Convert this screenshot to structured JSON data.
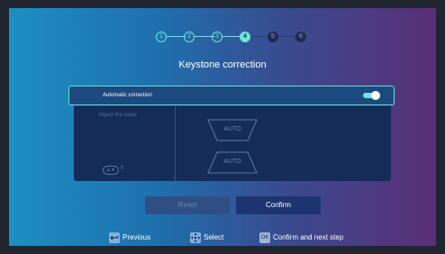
{
  "steps": {
    "items": [
      "1",
      "2",
      "3",
      "4",
      "5",
      "6"
    ],
    "current": 4
  },
  "title": "Keystone correction",
  "automatic_correction": {
    "label": "Automatic correction",
    "enabled": true
  },
  "adjust": {
    "label": "Adjust the value",
    "value": "0",
    "preview_top": "AUTO",
    "preview_bottom": "AUTO"
  },
  "buttons": {
    "reset": "Reset",
    "confirm": "Confirm"
  },
  "hints": {
    "previous": "Previous",
    "select": "Select",
    "ok_icon": "OK",
    "confirm_next": "Confirm and next step"
  },
  "icons": {
    "previous": "back-arrow-icon",
    "select": "dpad-icon",
    "adjust": "up-down-arrows-icon"
  },
  "colors": {
    "accent": "#6de6d4",
    "confirm_button": "#1d3470",
    "reset_button": "#2f4f84"
  }
}
